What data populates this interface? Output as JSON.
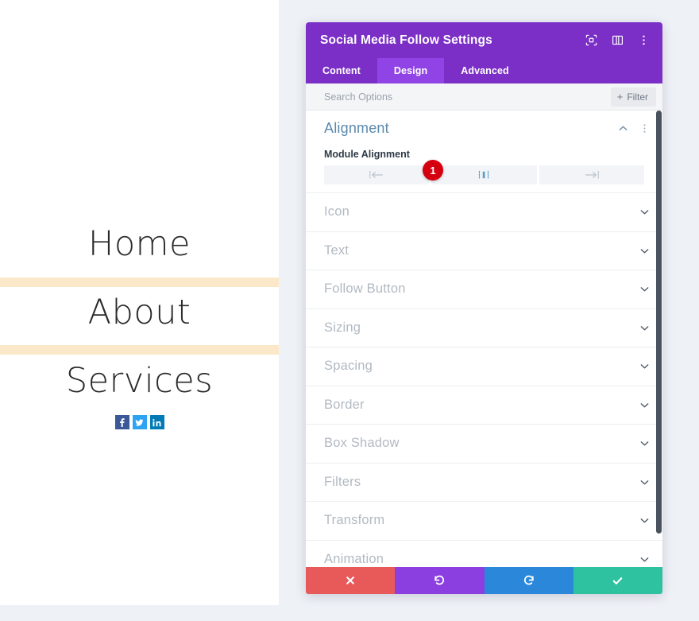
{
  "preview": {
    "menu_items": [
      {
        "label": "Home"
      },
      {
        "label": "About"
      },
      {
        "label": "Services"
      }
    ],
    "social_icons": [
      {
        "name": "facebook",
        "glyph": "f",
        "color": "#3b5998"
      },
      {
        "name": "twitter",
        "glyph": "t",
        "color": "#2ea3f2"
      },
      {
        "name": "linkedin",
        "glyph": "in",
        "color": "#007bb6"
      }
    ],
    "divider_color": "#fbe8c9"
  },
  "modal": {
    "title": "Social Media Follow Settings",
    "header_icons": [
      {
        "name": "focus-target-icon"
      },
      {
        "name": "layout-panel-icon"
      },
      {
        "name": "more-vertical-icon"
      }
    ],
    "tabs": [
      {
        "label": "Content",
        "active": false
      },
      {
        "label": "Design",
        "active": true
      },
      {
        "label": "Advanced",
        "active": false
      }
    ],
    "search": {
      "placeholder": "Search Options",
      "value": "",
      "filter_label": "Filter",
      "filter_plus": "+"
    },
    "alignment_section": {
      "title": "Alignment",
      "expanded": true,
      "field_label": "Module Alignment",
      "options": [
        {
          "name": "align-left",
          "selected": false
        },
        {
          "name": "align-center",
          "selected": true
        },
        {
          "name": "align-right",
          "selected": false
        }
      ],
      "badge": "1"
    },
    "collapsed_sections": [
      {
        "label": "Icon"
      },
      {
        "label": "Text"
      },
      {
        "label": "Follow Button"
      },
      {
        "label": "Sizing"
      },
      {
        "label": "Spacing"
      },
      {
        "label": "Border"
      },
      {
        "label": "Box Shadow"
      },
      {
        "label": "Filters"
      },
      {
        "label": "Transform"
      },
      {
        "label": "Animation"
      }
    ],
    "footer_buttons": [
      {
        "name": "cancel-button",
        "icon": "close-icon",
        "color": "#e8595a"
      },
      {
        "name": "undo-button",
        "icon": "undo-icon",
        "color": "#8b3fe0"
      },
      {
        "name": "redo-button",
        "icon": "redo-icon",
        "color": "#2b87da"
      },
      {
        "name": "save-button",
        "icon": "check-icon",
        "color": "#2ec2a0"
      }
    ]
  },
  "colors": {
    "purple_header": "#7b2fc6",
    "purple_active_tab": "#9044e6",
    "accent_blue": "#5b8aad",
    "badge_red": "#d5000f"
  }
}
